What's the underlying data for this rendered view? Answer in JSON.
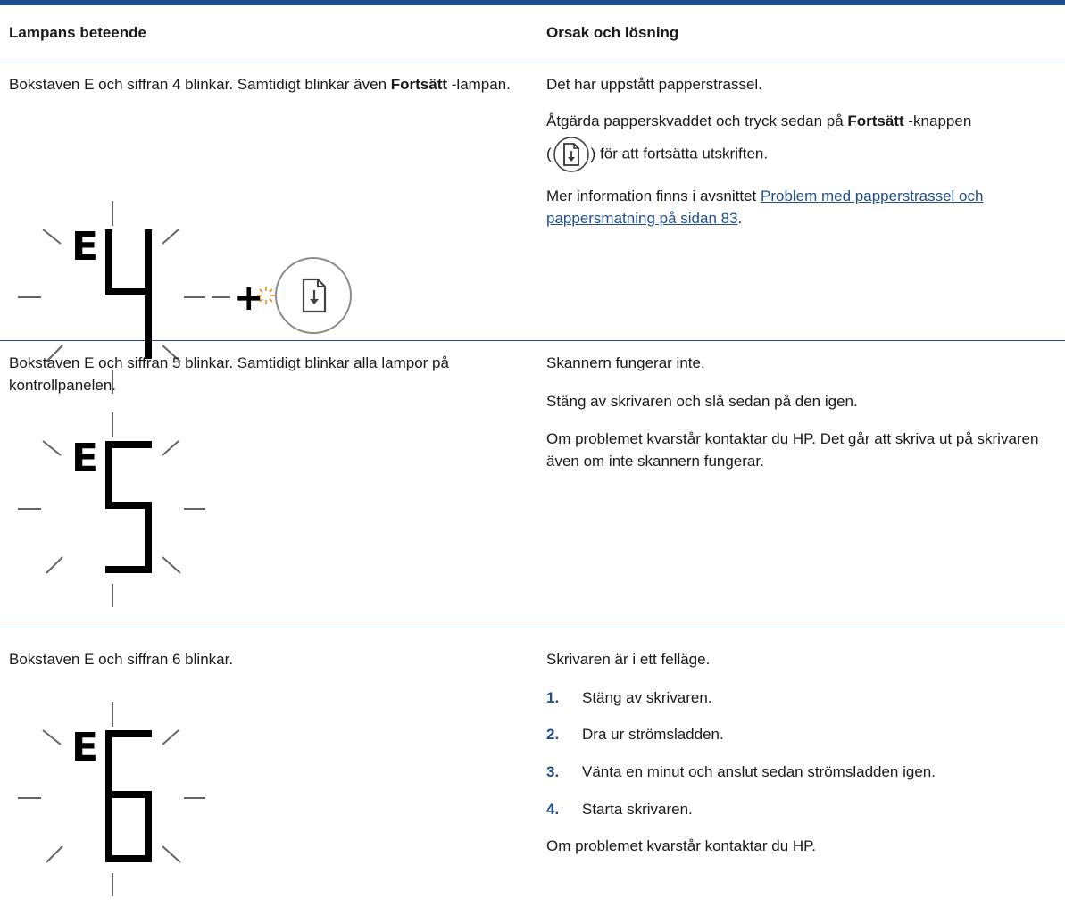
{
  "header": {
    "col_behavior": "Lampans beteende",
    "col_cause": "Orsak och lösning"
  },
  "rows": [
    {
      "behavior_pre": "Bokstaven E och siffran 4 blinkar. Samtidigt blinkar även ",
      "behavior_bold": "Fortsätt",
      "behavior_post": " -lampan.",
      "display_letter": "E",
      "display_digit": "4",
      "plus": "+",
      "cause": "Det har uppstått papperstrassel.",
      "fix_pre": "Åtgärda papperskvaddet och tryck sedan på ",
      "fix_bold": "Fortsätt",
      "fix_post": " -knappen",
      "fix_line2_open": "(",
      "fix_line2_close": ") för att fortsätta utskriften.",
      "more_pre": "Mer information finns i avsnittet ",
      "more_link": "Problem med papperstrassel och pappersmatning på sidan 83",
      "more_post": "."
    },
    {
      "behavior": "Bokstaven E och siffran 5 blinkar. Samtidigt blinkar alla lampor på kontrollpanelen.",
      "display_letter": "E",
      "display_digit": "5",
      "cause": "Skannern fungerar inte.",
      "step1": "Stäng av skrivaren och slå sedan på den igen.",
      "step2": "Om problemet kvarstår kontaktar du HP. Det går att skriva ut på skrivaren även om inte skannern fungerar."
    },
    {
      "behavior": "Bokstaven E och siffran 6 blinkar.",
      "display_letter": "E",
      "display_digit": "6",
      "cause": "Skrivaren är i ett felläge.",
      "steps": [
        {
          "num": "1.",
          "text": "Stäng av skrivaren."
        },
        {
          "num": "2.",
          "text": "Dra ur strömsladden."
        },
        {
          "num": "3.",
          "text": "Vänta en minut och anslut sedan strömsladden igen."
        },
        {
          "num": "4.",
          "text": "Starta skrivaren."
        }
      ],
      "footer": "Om problemet kvarstår kontaktar du HP."
    }
  ],
  "colors": {
    "rule": "#1f4e8a",
    "link": "#1f4e8a",
    "blink_accent": "#f28c1e"
  }
}
